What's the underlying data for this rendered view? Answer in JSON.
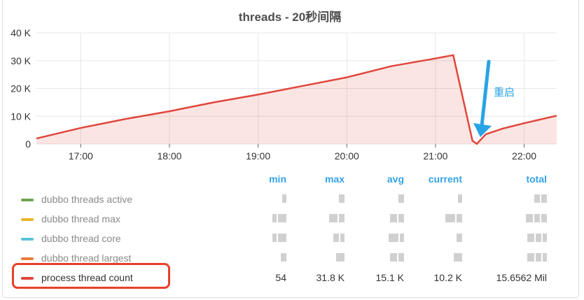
{
  "panel": {
    "title": "threads - 20秒间隔",
    "annotation": "重启"
  },
  "legend": {
    "headers": {
      "min": "min",
      "max": "max",
      "avg": "avg",
      "current": "current",
      "total": "total"
    },
    "series": [
      {
        "name": "dubbo threads active",
        "color": "#6ea44f",
        "min": "",
        "max": "",
        "avg": "",
        "current": "",
        "total": ""
      },
      {
        "name": "dubbo thread max",
        "color": "#e8b52b",
        "min": "",
        "max": "",
        "avg": "",
        "current": "",
        "total": ""
      },
      {
        "name": "dubbo thread core",
        "color": "#5bc4d6",
        "min": "",
        "max": "",
        "avg": "",
        "current": "",
        "total": ""
      },
      {
        "name": "dubbo thread largest",
        "color": "#ea7d3c",
        "min": "",
        "max": "",
        "avg": "",
        "current": "",
        "total": ""
      },
      {
        "name": "process thread count",
        "color": "#e0463c",
        "min": "54",
        "max": "31.8 K",
        "avg": "15.1 K",
        "current": "10.2 K",
        "total": "15.6562 Mil"
      }
    ]
  },
  "chart_data": {
    "type": "area",
    "title": "threads - 20秒间隔",
    "xlabel": "",
    "ylabel": "",
    "x_ticks": [
      "17:00",
      "18:00",
      "19:00",
      "20:00",
      "21:00",
      "22:00"
    ],
    "y_ticks": [
      "0",
      "10 K",
      "20 K",
      "30 K",
      "40 K"
    ],
    "ylim": [
      0,
      40000
    ],
    "xlim": [
      "16:30",
      "22:22"
    ],
    "grid": true,
    "series": [
      {
        "name": "process thread count",
        "color": "#e0463c",
        "x": [
          "16:30",
          "17:00",
          "17:30",
          "18:00",
          "18:30",
          "19:00",
          "19:30",
          "20:00",
          "20:30",
          "21:00",
          "21:12",
          "21:25",
          "21:28",
          "21:34",
          "21:45",
          "22:00",
          "22:22"
        ],
        "values": [
          2000,
          5800,
          9000,
          11800,
          15000,
          17800,
          20900,
          24000,
          28000,
          30800,
          32000,
          1200,
          54,
          3500,
          5500,
          7500,
          10200
        ]
      }
    ]
  }
}
